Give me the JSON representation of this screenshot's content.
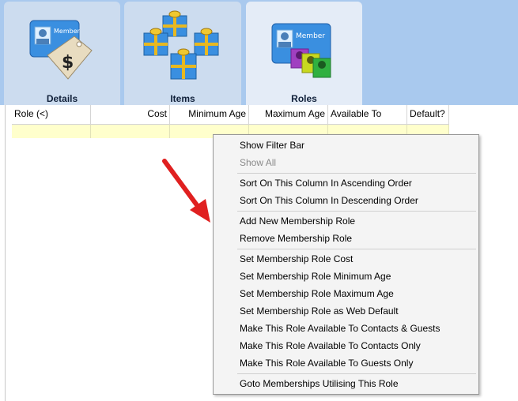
{
  "tabs": [
    {
      "label": "Details",
      "icon": "member-card-price-tag-icon",
      "active": false
    },
    {
      "label": "Items",
      "icon": "gift-boxes-icon",
      "active": false
    },
    {
      "label": "Roles",
      "icon": "member-card-roles-icon",
      "active": true
    }
  ],
  "grid": {
    "columns": [
      "Role (<)",
      "Cost",
      "Minimum Age",
      "Maximum Age",
      "Available To",
      "Default?"
    ]
  },
  "context_menu": {
    "items": [
      {
        "label": "Show Filter Bar",
        "enabled": true
      },
      {
        "label": "Show All",
        "enabled": false
      },
      {
        "label": "Sort On This Column In Ascending Order",
        "enabled": true
      },
      {
        "label": "Sort On This Column In Descending Order",
        "enabled": true
      },
      {
        "label": "Add New Membership Role",
        "enabled": true
      },
      {
        "label": "Remove Membership Role",
        "enabled": true
      },
      {
        "label": "Set Membership Role Cost",
        "enabled": true
      },
      {
        "label": "Set Membership Role Minimum Age",
        "enabled": true
      },
      {
        "label": "Set Membership Role Maximum Age",
        "enabled": true
      },
      {
        "label": "Set Membership Role as Web Default",
        "enabled": true
      },
      {
        "label": "Make This Role Available To Contacts & Guests",
        "enabled": true
      },
      {
        "label": "Make This Role Available To Contacts Only",
        "enabled": true
      },
      {
        "label": "Make This Role Available To Guests Only",
        "enabled": true
      },
      {
        "label": "Goto Memberships Utilising This Role",
        "enabled": true
      }
    ]
  },
  "icons": {
    "card_text": "Member",
    "price_symbol": "$",
    "annotation": "red-arrow-icon"
  },
  "colors": {
    "tab_band": "#a9c9ee",
    "new_row": "#ffffcc",
    "menu_bg": "#f4f4f4",
    "arrow": "#e02020"
  }
}
